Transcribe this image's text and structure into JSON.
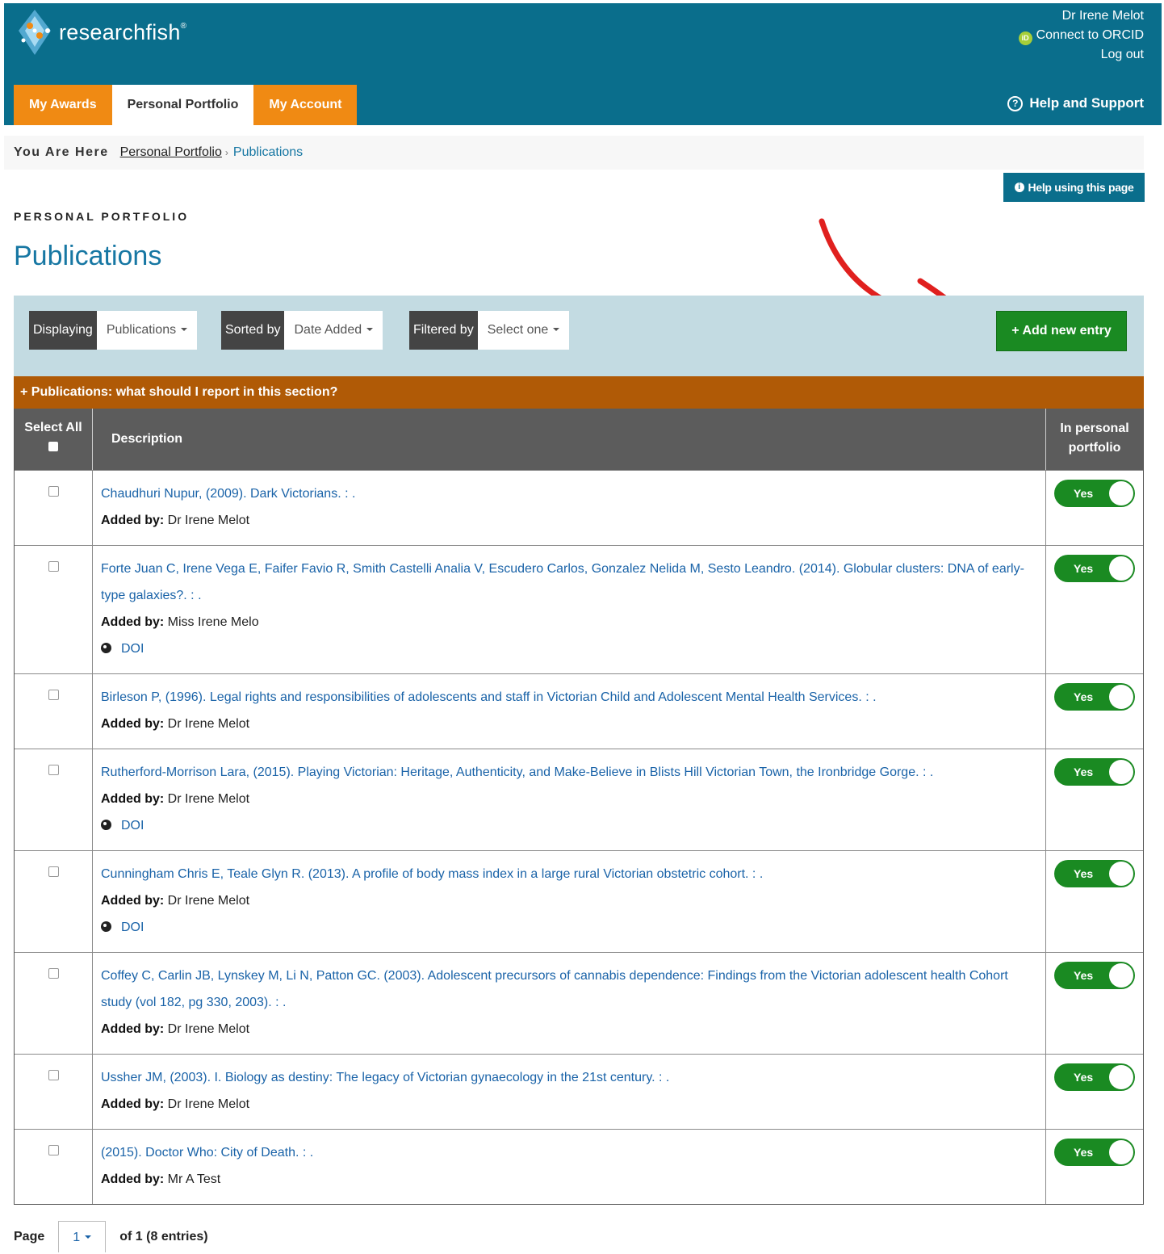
{
  "header": {
    "logo_text": "researchfish",
    "logo_mark": "®",
    "user_name": "Dr Irene Melot",
    "orcid_icon": "iD",
    "orcid_link": "Connect to ORCID",
    "logout": "Log out",
    "help_support": "Help and Support",
    "help_icon": "?",
    "tabs": [
      {
        "label": "My Awards"
      },
      {
        "label": "Personal Portfolio"
      },
      {
        "label": "My Account"
      }
    ]
  },
  "breadcrumb": {
    "label": "You Are Here",
    "link": "Personal Portfolio",
    "separator": "›",
    "current": "Publications"
  },
  "help_page": {
    "icon": "i",
    "label": "Help using this page"
  },
  "section_label": "PERSONAL PORTFOLIO",
  "page_title": "Publications",
  "filters": {
    "displaying_label": "Displaying",
    "displaying_value": "Publications",
    "sorted_label": "Sorted by",
    "sorted_value": "Date Added",
    "filtered_label": "Filtered by",
    "filtered_value": "Select one",
    "add_button": "+ Add new entry"
  },
  "info_bar": "+ Publications: what should I report in this section?",
  "table": {
    "header_select": "Select All",
    "header_description": "Description",
    "header_portfolio_line1": "In personal",
    "header_portfolio_line2": "portfolio",
    "added_by_label": "Added by:",
    "doi_label": "DOI",
    "toggle_label": "Yes",
    "rows": [
      {
        "citation": "Chaudhuri Nupur, (2009). Dark Victorians. : .",
        "added_by": "Dr Irene Melot",
        "has_doi": false
      },
      {
        "citation": "Forte Juan C, Irene Vega E, Faifer Favio R, Smith Castelli Analia V, Escudero Carlos, Gonzalez Nelida M, Sesto Leandro. (2014). Globular clusters: DNA of early-type galaxies?. : .",
        "added_by": "Miss Irene Melo",
        "has_doi": true
      },
      {
        "citation": "Birleson P, (1996). Legal rights and responsibilities of adolescents and staff in Victorian Child and Adolescent Mental Health Services. : .",
        "added_by": "Dr Irene Melot",
        "has_doi": false
      },
      {
        "citation": "Rutherford-Morrison Lara, (2015). Playing Victorian: Heritage, Authenticity, and Make-Believe in Blists Hill Victorian Town, the Ironbridge Gorge. : .",
        "added_by": "Dr Irene Melot",
        "has_doi": true
      },
      {
        "citation": "Cunningham Chris E, Teale Glyn R. (2013). A profile of body mass index in a large rural Victorian obstetric cohort. : .",
        "added_by": "Dr Irene Melot",
        "has_doi": true
      },
      {
        "citation": "Coffey C, Carlin JB, Lynskey M, Li N, Patton GC. (2003). Adolescent precursors of cannabis dependence: Findings from the Victorian adolescent health Cohort study (vol 182, pg 330, 2003). : .",
        "added_by": "Dr Irene Melot",
        "has_doi": false
      },
      {
        "citation": "Ussher JM, (2003). I. Biology as destiny: The legacy of Victorian gynaecology in the 21st century. : .",
        "added_by": "Dr Irene Melot",
        "has_doi": false
      },
      {
        "citation": "(2015). Doctor Who: City of Death. : .",
        "added_by": "Mr A Test",
        "has_doi": false
      }
    ]
  },
  "pagination": {
    "label": "Page",
    "current": "1",
    "of_text": "of 1 (8 entries)"
  },
  "colors": {
    "header_bg": "#0a6e8c",
    "tab_orange": "#f08a13",
    "add_green": "#1a8a22",
    "info_orange": "#b05a06",
    "link_blue": "#1a63a8",
    "arrow_red": "#e0201e"
  }
}
